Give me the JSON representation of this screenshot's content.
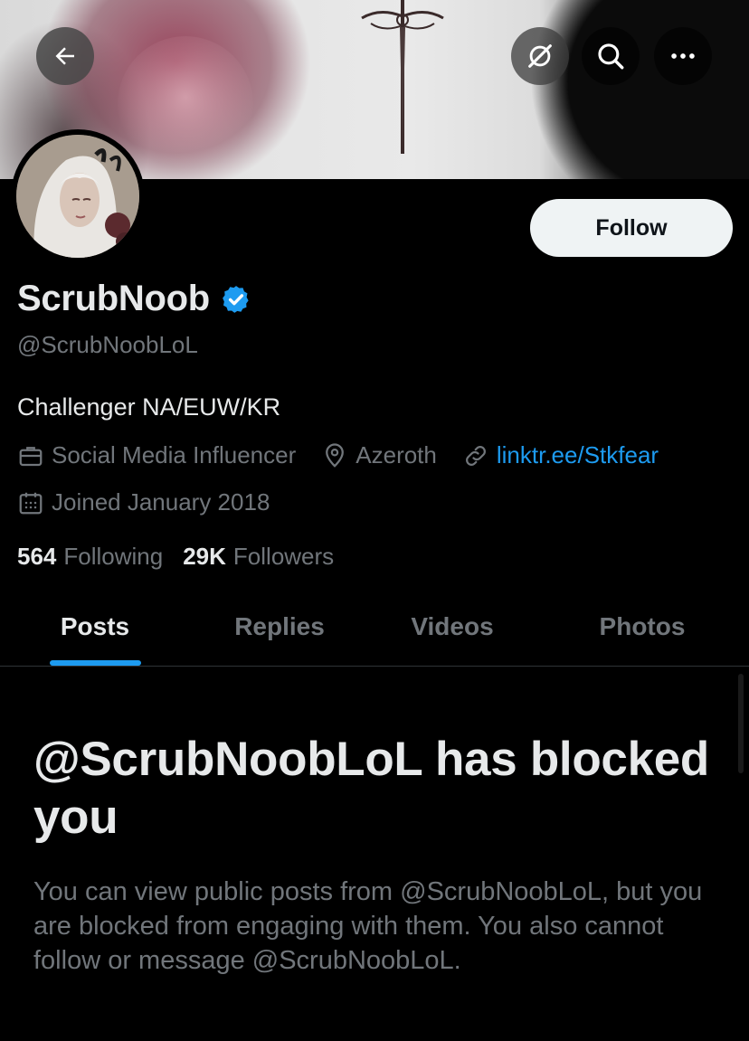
{
  "header": {
    "back_icon": "arrow-left-icon",
    "grok_icon": "grok-icon",
    "search_icon": "search-icon",
    "more_icon": "more-horizontal-icon"
  },
  "profile": {
    "display_name": "ScrubNoob",
    "verified": true,
    "handle": "@ScrubNoobLoL",
    "bio": "Challenger NA/EUW/KR",
    "category": "Social Media Influencer",
    "location": "Azeroth",
    "link": "linktr.ee/Stkfear",
    "joined": "Joined January 2018",
    "following_count": "564",
    "following_label": "Following",
    "followers_count": "29K",
    "followers_label": "Followers"
  },
  "actions": {
    "follow_label": "Follow"
  },
  "tabs": [
    {
      "label": "Posts",
      "active": true
    },
    {
      "label": "Replies",
      "active": false
    },
    {
      "label": "Videos",
      "active": false
    },
    {
      "label": "Photos",
      "active": false
    }
  ],
  "blocked": {
    "title": "@ScrubNoobLoL has blocked you",
    "body": "You can view public posts from @ScrubNoobLoL, but you are blocked from engaging with them. You also cannot follow or message @ScrubNoobLoL."
  },
  "colors": {
    "background": "#000000",
    "text_primary": "#e7e9ea",
    "text_secondary": "#71767b",
    "accent": "#1d9bf0",
    "follow_button_bg": "#eff3f4"
  }
}
